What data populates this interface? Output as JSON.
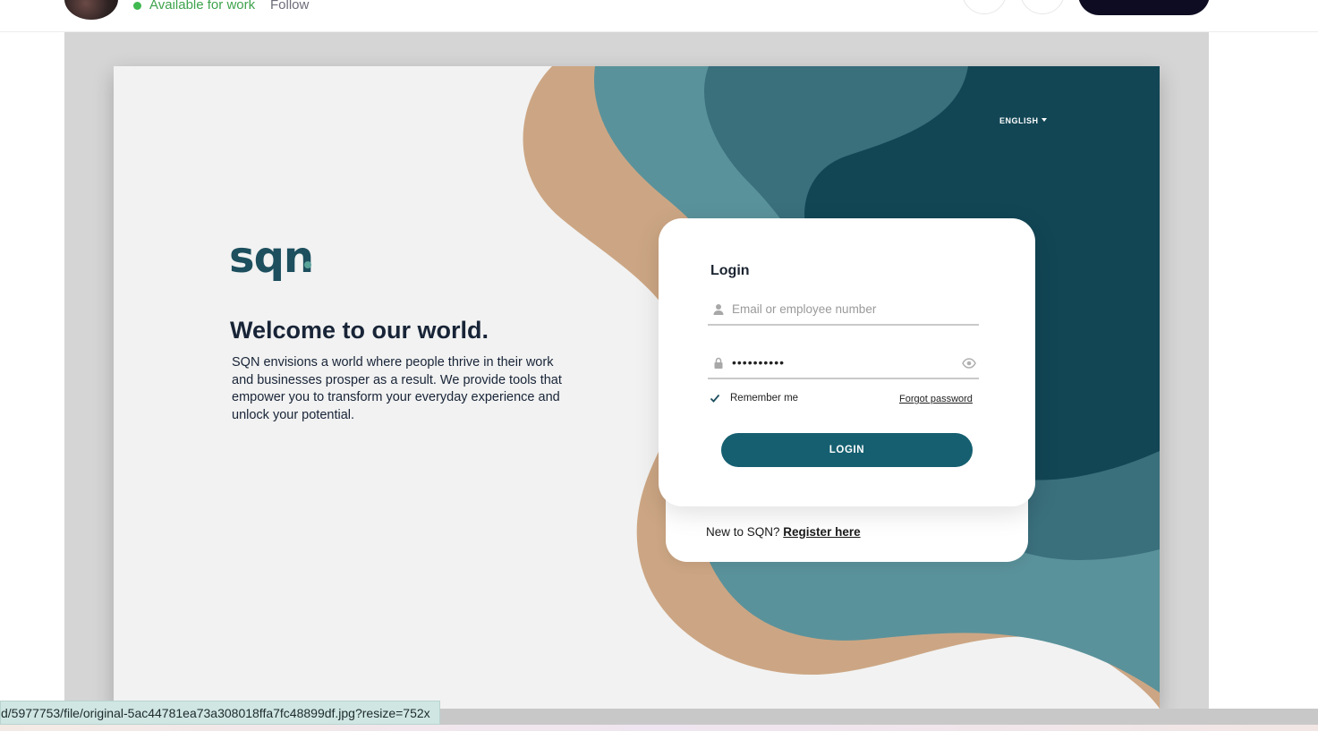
{
  "header": {
    "availability": "Available for work",
    "follow": "Follow"
  },
  "design": {
    "language": "ENGLISH",
    "logo": "sqn",
    "welcome_title": "Welcome to our world.",
    "tagline": "SQN envisions a world where people thrive in their work and businesses prosper as a result. We provide tools that empower you to transform your everyday experience and unlock your potential.",
    "login": {
      "title": "Login",
      "email_placeholder": "Email or employee number",
      "password_value": "••••••••••",
      "remember_label": "Remember me",
      "forgot_label": "Forgot password",
      "button_label": "LOGIN"
    },
    "register": {
      "prompt": "New to SQN?",
      "link": "Register here"
    }
  },
  "status_bar": {
    "url": "d/5977753/file/original-5ac44781ea73a308018ffa7fc48899df.jpg?resize=752x"
  },
  "colors": {
    "primary": "#155f70",
    "dark_teal": "#124655",
    "mid_teal": "#3a6f7c",
    "light_teal": "#5a929b",
    "sand": "#cca684",
    "available_green": "#3fb950"
  },
  "icons": [
    "user-icon",
    "lock-icon",
    "eye-icon",
    "check-icon",
    "caret-down-icon"
  ]
}
